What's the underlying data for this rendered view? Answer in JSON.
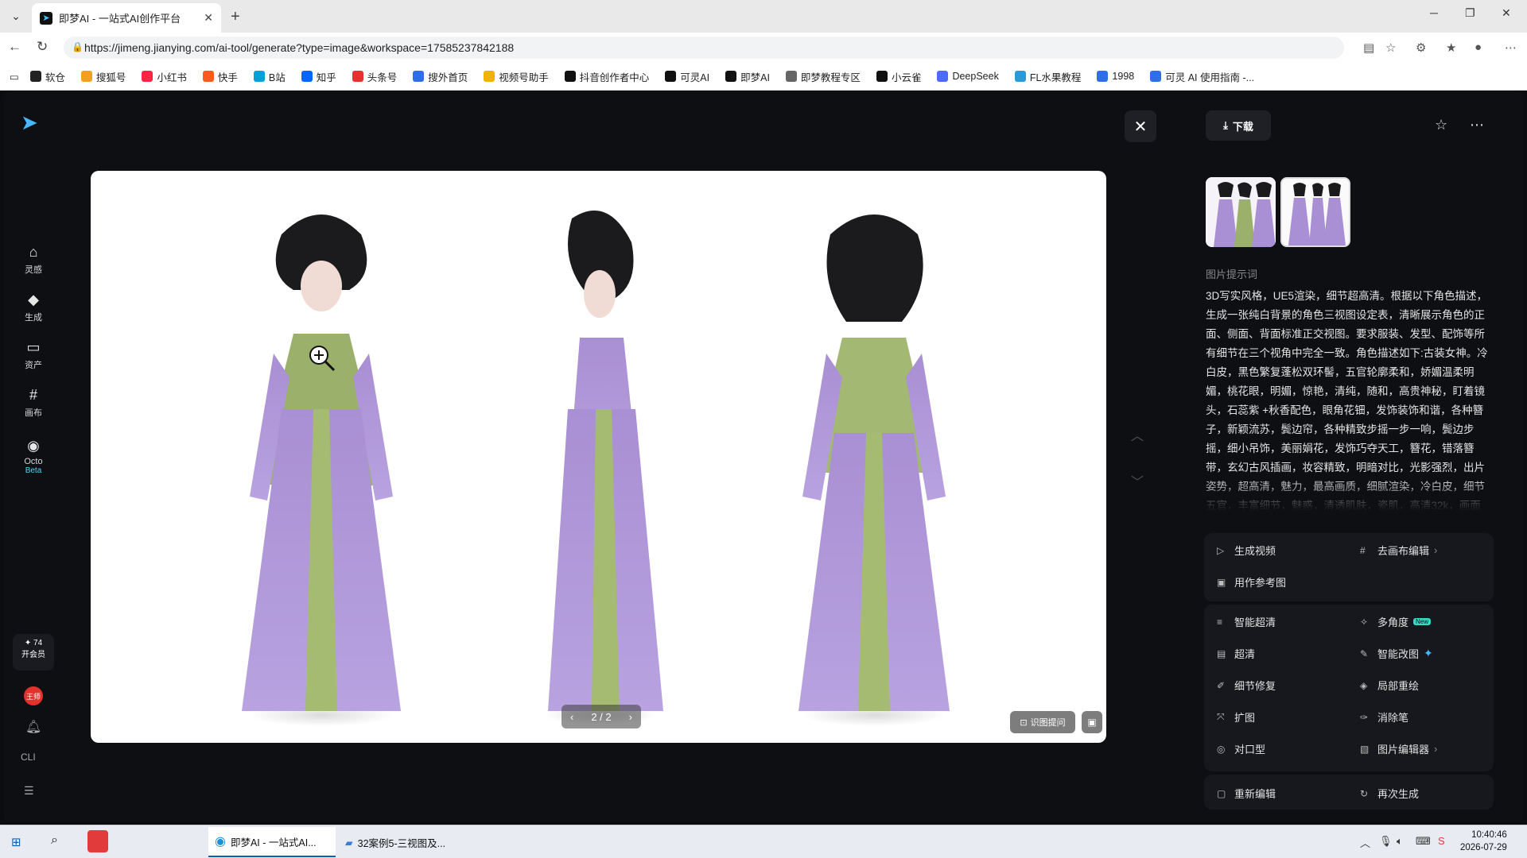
{
  "browser": {
    "tab_title": "即梦AI - 一站式AI创作平台",
    "url": "https://jimeng.jianying.com/ai-tool/generate?type=image&workspace=17585237842188"
  },
  "bookmarks": [
    {
      "label": "软仓",
      "color": "#222222"
    },
    {
      "label": "搜狐号",
      "color": "#f3a020"
    },
    {
      "label": "小红书",
      "color": "#ff2442"
    },
    {
      "label": "快手",
      "color": "#ff5a1f"
    },
    {
      "label": "B站",
      "color": "#00a1d6"
    },
    {
      "label": "知乎",
      "color": "#0066ff"
    },
    {
      "label": "头条号",
      "color": "#e8312c"
    },
    {
      "label": "搜外首页",
      "color": "#2f6ee8"
    },
    {
      "label": "视频号助手",
      "color": "#f0b400"
    },
    {
      "label": "抖音创作者中心",
      "color": "#111111"
    },
    {
      "label": "可灵AI",
      "color": "#111111"
    },
    {
      "label": "即梦AI",
      "color": "#111111"
    },
    {
      "label": "即梦教程专区",
      "color": "#666666"
    },
    {
      "label": "小云雀",
      "color": "#111111"
    },
    {
      "label": "DeepSeek",
      "color": "#4d6bfe"
    },
    {
      "label": "FL水果教程",
      "color": "#2a9bd8"
    },
    {
      "label": "1998",
      "color": "#2f6ee8"
    },
    {
      "label": "可灵 AI 使用指南 -...",
      "color": "#2f6ee8"
    }
  ],
  "leftnav": {
    "items": [
      {
        "label": "灵感",
        "icon": "⌂"
      },
      {
        "label": "生成",
        "icon": "◆"
      },
      {
        "label": "资产",
        "icon": "▭"
      },
      {
        "label": "画布",
        "icon": "#"
      },
      {
        "label": "Octo",
        "icon": "◉"
      }
    ],
    "beta": "Beta",
    "vip_points": "✦ 74",
    "vip_label": "开会员",
    "avatar_text": "王师",
    "cli": "CLI"
  },
  "viewer": {
    "page_indicator": "2 / 2",
    "ask_label": "识图提问"
  },
  "panel": {
    "download_label": "下载",
    "prompt_label": "图片提示词",
    "prompt_text": "3D写实风格，UE5渲染，细节超高清。根据以下角色描述，生成一张纯白背景的角色三视图设定表，清晰展示角色的正面、侧面、背面标准正交视图。要求服装、发型、配饰等所有细节在三个视角中完全一致。角色描述如下:古装女神。冷白皮，黑色繁复蓬松双环髻，五官轮廓柔和，娇媚温柔明媚，桃花眼，明媚，惊艳，清纯，随和，高贵神秘，盯着镜头，石蕊紫 +秋香配色，眼角花钿，发饰装饰和谐，各种簪子，新颖流苏，鬓边帘，各种精致步摇一步一响，鬓边步摇，细小吊饰，美丽娟花，发饰巧夺天工，簪花，错落簪带，玄幻古风插画，妆容精致，明暗对比，光影强烈，出片姿势，超高清，魅力，最高画质，细腻渲染，冷白皮，细节五官，丰富细节，魅惑，清透肌肤，瓷肌，高清32k，画面",
    "card1": [
      {
        "label": "生成视频",
        "icon": "▷"
      },
      {
        "label": "去画布编辑",
        "icon": "#"
      },
      {
        "label": "用作参考图",
        "icon": "▣"
      }
    ],
    "card2": [
      {
        "label": "智能超清",
        "icon": "≡"
      },
      {
        "label": "多角度",
        "icon": "✧",
        "badge": "New"
      },
      {
        "label": "超清",
        "icon": "▤"
      },
      {
        "label": "智能改图",
        "icon": "✎"
      },
      {
        "label": "细节修复",
        "icon": "✐"
      },
      {
        "label": "局部重绘",
        "icon": "◈"
      },
      {
        "label": "扩图",
        "icon": "⤧"
      },
      {
        "label": "消除笔",
        "icon": "✑"
      },
      {
        "label": "对口型",
        "icon": "◎"
      },
      {
        "label": "图片编辑器",
        "icon": "▧"
      }
    ],
    "card3": [
      {
        "label": "重新编辑",
        "icon": "▢"
      },
      {
        "label": "再次生成",
        "icon": "↻"
      }
    ]
  },
  "taskbar": {
    "apps": [
      {
        "label": "即梦AI - 一站式AI...",
        "active": true
      },
      {
        "label": "32案例5-三视图及...",
        "active": false
      }
    ],
    "time": "10:40:46",
    "date": "2026-07-29"
  }
}
